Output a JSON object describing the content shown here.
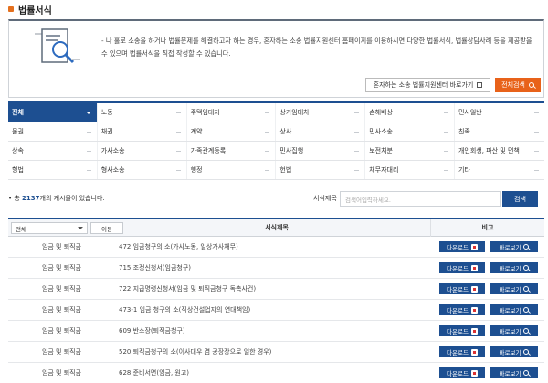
{
  "page": {
    "title": "법률서식"
  },
  "intro": {
    "description": "- 나 홀로 소송을 하거나 법률문제를 해결하고자 하는 경우, 혼자하는 소송 법률지원센터 홈페이지를 이용하시면 다양한 법률서식, 법률상담사례 등을 제공받을 수 있으며 법률서식을 직접 작성할 수 있습니다.",
    "link_button": "혼자하는 소송 법률지원센터 바로가기",
    "search_all_button": "전체검색"
  },
  "categories": [
    [
      "전체",
      "노동",
      "주택임대차",
      "상가임대차",
      "손해배상",
      "민사일반"
    ],
    [
      "물권",
      "채권",
      "계약",
      "상사",
      "민사소송",
      "친족"
    ],
    [
      "상속",
      "가사소송",
      "가족관계등록",
      "민사집행",
      "보전처분",
      "개인회생, 파산 및 면책"
    ],
    [
      "형법",
      "형사소송",
      "행정",
      "헌법",
      "채무자대리",
      "기타"
    ]
  ],
  "list": {
    "count_prefix": "총",
    "count": "2137",
    "count_suffix": "개의 게시물이 있습니다.",
    "search_label": "서식제목",
    "search_placeholder": "검색어입력하세요.",
    "search_button": "검색"
  },
  "table": {
    "filter_value": "전체",
    "move_button": "이동",
    "col_title": "서식제목",
    "col_ref": "비고",
    "download_label": "다운로드",
    "view_label": "바로보기",
    "rows": [
      {
        "category": "임금 및 퇴직금",
        "name": "472 임금청구의 소(가사노동, 일상가사채무)"
      },
      {
        "category": "임금 및 퇴직금",
        "name": "715 조정신청서(임금청구)"
      },
      {
        "category": "임금 및 퇴직금",
        "name": "722 지급명령신청서(임금 및 퇴직금청구 독촉사건)"
      },
      {
        "category": "임금 및 퇴직금",
        "name": "473-1 임금 청구의 소(직상건설업자의 연대책임)"
      },
      {
        "category": "임금 및 퇴직금",
        "name": "609 반소장(퇴직금청구)"
      },
      {
        "category": "임금 및 퇴직금",
        "name": "520 퇴직금청구의 소(이사대우 겸 공장장으로 일한 경우)"
      },
      {
        "category": "임금 및 퇴직금",
        "name": "628 준비서면(임금, 원고)"
      }
    ]
  },
  "colors": {
    "primary": "#1d4f91",
    "accent": "#e8621a"
  }
}
